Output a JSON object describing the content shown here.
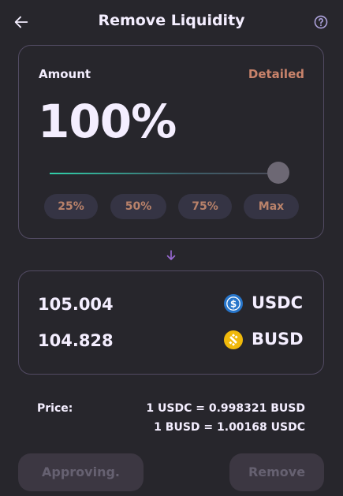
{
  "header": {
    "title": "Remove Liquidity",
    "back_icon": "arrow-left-icon",
    "help_icon": "question-circle-icon"
  },
  "amount": {
    "label": "Amount",
    "detailed_label": "Detailed",
    "percent_text": "100%",
    "slider_value": 1.0,
    "buttons": [
      {
        "label": "25%"
      },
      {
        "label": "50%"
      },
      {
        "label": "75%"
      },
      {
        "label": "Max"
      }
    ]
  },
  "tokens": [
    {
      "amount": "105.004",
      "symbol": "USDC",
      "icon": "usdc-icon",
      "color": "#2775ca"
    },
    {
      "amount": "104.828",
      "symbol": "BUSD",
      "icon": "busd-icon",
      "color": "#f0b90b"
    }
  ],
  "price": {
    "label": "Price:",
    "line1": "1 USDC = 0.998321 BUSD",
    "line2": "1 BUSD = 1.00168 USDC"
  },
  "actions": {
    "approving_label": "Approving.",
    "remove_label": "Remove"
  },
  "colors": {
    "background": "#27262c",
    "accent": "#31d0aa",
    "secondary": "#c9836b",
    "text": "#f4eeff"
  }
}
